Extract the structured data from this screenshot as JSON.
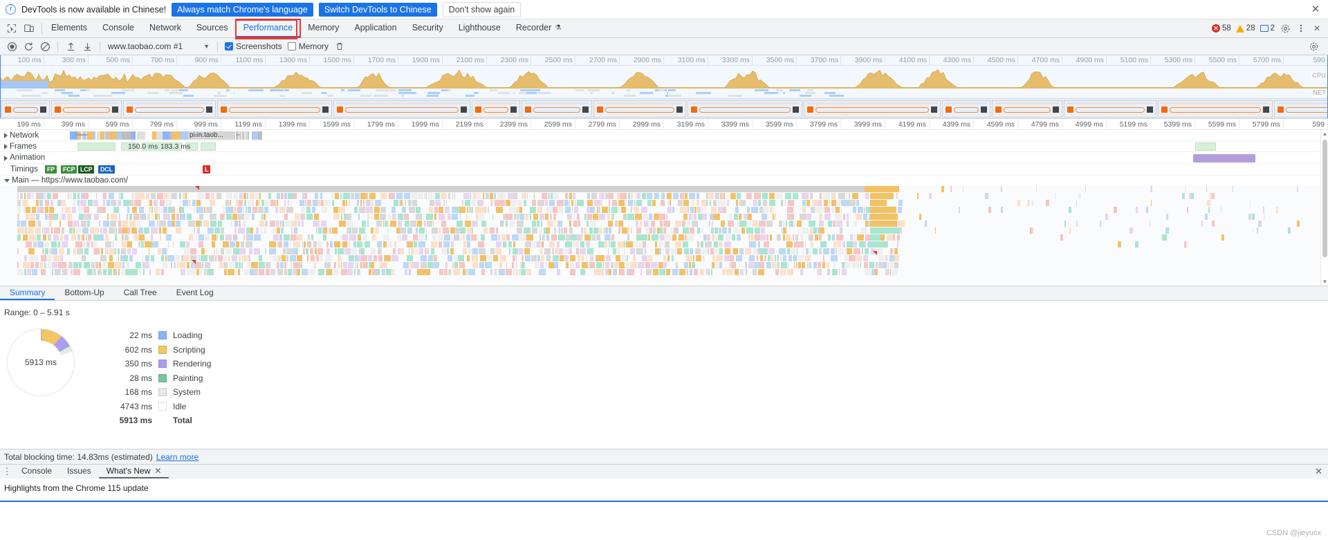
{
  "infobar": {
    "message": "DevTools is now available in Chinese!",
    "buttons": [
      {
        "label": "Always match Chrome's language",
        "style": "blue"
      },
      {
        "label": "Switch DevTools to Chinese",
        "style": "blue"
      },
      {
        "label": "Don't show again",
        "style": "plain"
      }
    ],
    "close_icon": "close-icon"
  },
  "tabbar": {
    "inspect_icon": "inspect-element-icon",
    "device_icon": "device-toolbar-icon",
    "tabs": [
      {
        "label": "Elements",
        "active": false
      },
      {
        "label": "Console",
        "active": false
      },
      {
        "label": "Network",
        "active": false
      },
      {
        "label": "Sources",
        "active": false
      },
      {
        "label": "Performance",
        "active": true,
        "highlighted": true
      },
      {
        "label": "Memory",
        "active": false
      },
      {
        "label": "Application",
        "active": false
      },
      {
        "label": "Security",
        "active": false
      },
      {
        "label": "Lighthouse",
        "active": false
      },
      {
        "label": "Recorder",
        "active": false,
        "suffix_icon": "flask-icon"
      }
    ],
    "error_count": "58",
    "warning_count": "28",
    "message_count": "2",
    "settings_icon": "gear-icon",
    "more_icon": "more-vertical-icon",
    "close_icon": "close-icon"
  },
  "perfbar": {
    "record_icon": "record-circle-icon",
    "reload_icon": "reload-record-icon",
    "clear_icon": "clear-icon",
    "upload_icon": "upload-profile-icon",
    "download_icon": "download-profile-icon",
    "url_value": "www.taobao.com #1",
    "url_caret": "chevron-down-icon",
    "screenshots_label": "Screenshots",
    "screenshots_checked": true,
    "memory_label": "Memory",
    "memory_checked": false,
    "trash_icon": "trash-icon",
    "capture_settings_icon": "capture-settings-icon"
  },
  "overview": {
    "cpu_label": "CPU",
    "net_label": "NET",
    "ticks": [
      "100 ms",
      "300 ms",
      "500 ms",
      "700 ms",
      "900 ms",
      "1100 ms",
      "1300 ms",
      "1500 ms",
      "1700 ms",
      "1900 ms",
      "2100 ms",
      "2300 ms",
      "2500 ms",
      "2700 ms",
      "2900 ms",
      "3100 ms",
      "3300 ms",
      "3500 ms",
      "3700 ms",
      "3900 ms",
      "4100 ms",
      "4300 ms",
      "4500 ms",
      "4700 ms",
      "4900 ms",
      "5100 ms",
      "5300 ms",
      "5500 ms",
      "5700 ms",
      "590"
    ]
  },
  "timeline": {
    "ticks": [
      "199 ms",
      "399 ms",
      "599 ms",
      "799 ms",
      "999 ms",
      "1199 ms",
      "1399 ms",
      "1599 ms",
      "1799 ms",
      "1999 ms",
      "2199 ms",
      "2399 ms",
      "2599 ms",
      "2799 ms",
      "2999 ms",
      "3199 ms",
      "3399 ms",
      "3599 ms",
      "3799 ms",
      "3999 ms",
      "4199 ms",
      "4399 ms",
      "4599 ms",
      "4799 ms",
      "4999 ms",
      "5199 ms",
      "5399 ms",
      "5599 ms",
      "5799 ms",
      "599"
    ],
    "tracks": [
      {
        "name": "Network",
        "expanded": false
      },
      {
        "name": "Frames",
        "expanded": false
      },
      {
        "name": "Animation",
        "expanded": false
      },
      {
        "name": "Timings",
        "expanded": false
      },
      {
        "name": "Main — https://www.taobao.com/",
        "expanded": true
      }
    ],
    "network_request_label": "pi.in.taob...",
    "frame_durations": [
      "150.0 ms",
      "183.3 ms"
    ],
    "timing_markers": [
      {
        "label": "FP",
        "color": "#388e3c"
      },
      {
        "label": "FCP",
        "color": "#388e3c"
      },
      {
        "label": "LCP",
        "color": "#1b5e20"
      },
      {
        "label": "DCL",
        "color": "#1565c0"
      }
    ],
    "lcp_marker": {
      "label": "L",
      "color": "#d32f2f"
    }
  },
  "bottom_tabs": [
    {
      "label": "Summary",
      "active": true
    },
    {
      "label": "Bottom-Up",
      "active": false
    },
    {
      "label": "Call Tree",
      "active": false
    },
    {
      "label": "Event Log",
      "active": false
    }
  ],
  "summary": {
    "range_label": "Range: 0 – 5.91 s",
    "donut_center": "5913 ms"
  },
  "chart_data": {
    "type": "pie",
    "title": "Range: 0 – 5.91 s",
    "center_label": "5913 ms",
    "categories": [
      "Loading",
      "Scripting",
      "Rendering",
      "Painting",
      "System",
      "Idle"
    ],
    "values": [
      22,
      602,
      350,
      28,
      168,
      4743
    ],
    "value_labels": [
      "22 ms",
      "602 ms",
      "350 ms",
      "28 ms",
      "168 ms",
      "4743 ms"
    ],
    "colors": [
      "#8ab4f8",
      "#f1c664",
      "#ab9df2",
      "#74c69d",
      "#e8e8e8",
      "#ffffff"
    ],
    "total_label": "Total",
    "total_value": "5913 ms",
    "unit": "ms"
  },
  "tbt": {
    "text": "Total blocking time: 14.83ms (estimated)",
    "link_label": "Learn more"
  },
  "drawer": {
    "more_icon": "more-vertical-icon",
    "tabs": [
      {
        "label": "Console",
        "active": false,
        "closable": false
      },
      {
        "label": "Issues",
        "active": false,
        "closable": false
      },
      {
        "label": "What's New",
        "active": true,
        "closable": true
      }
    ],
    "close_icon": "close-icon",
    "content_title": "Highlights from the Chrome 115 update"
  },
  "watermark": "CSDN @jieyucx"
}
